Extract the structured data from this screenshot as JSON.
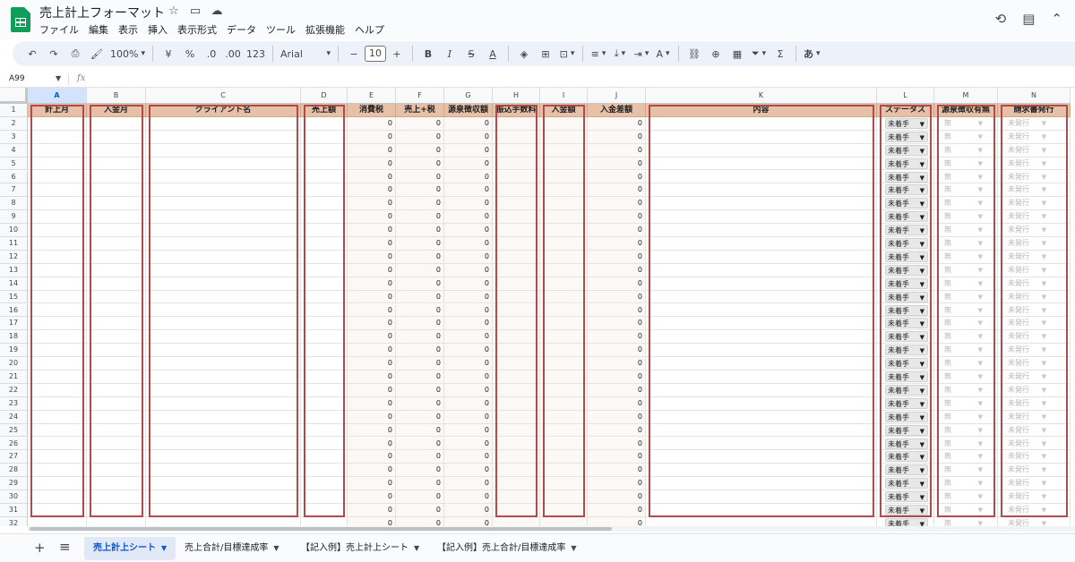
{
  "app": {
    "title": "売上計上フォーマット",
    "menu": [
      "ファイル",
      "編集",
      "表示",
      "挿入",
      "表示形式",
      "データ",
      "ツール",
      "拡張機能",
      "ヘルプ"
    ]
  },
  "toolbar": {
    "zoom": "100%",
    "currency": "¥",
    "percent": "%",
    "dec_decrease": ".0",
    "dec_increase": ".00",
    "number_format": "123",
    "font": "Arial",
    "font_size": "10",
    "bold": "B",
    "italic": "I",
    "strike": "S",
    "text_color": "A",
    "input_tool": "あ"
  },
  "formula_bar": {
    "name_box": "A99",
    "fx": "fx"
  },
  "columns": [
    "A",
    "B",
    "C",
    "D",
    "E",
    "F",
    "G",
    "H",
    "I",
    "J",
    "K",
    "L",
    "M",
    "N"
  ],
  "active_column": "A",
  "header_row": [
    "計上月",
    "入金月",
    "クライアント名",
    "売上額",
    "消費税",
    "売上+税",
    "源泉徴収額",
    "振込手数料",
    "入金額",
    "入金差額",
    "内容",
    "ステータス",
    "源泉徴収有無",
    "請求書発行"
  ],
  "rows": [
    "1",
    "2",
    "3",
    "4",
    "5",
    "6",
    "7",
    "8",
    "9",
    "10",
    "11",
    "12",
    "13",
    "14",
    "15",
    "16",
    "17",
    "18",
    "19",
    "20",
    "21",
    "22",
    "23",
    "24",
    "25",
    "26",
    "27",
    "28",
    "29",
    "30",
    "31",
    "32"
  ],
  "cell_values": {
    "zero": "0",
    "status": "未着手",
    "withholding": "無",
    "invoice": "未発行"
  },
  "sheets": [
    {
      "label": "売上計上シート",
      "active": true
    },
    {
      "label": "売上合計/目標達成率",
      "active": false
    },
    {
      "label": "【記入例】売上計上シート",
      "active": false
    },
    {
      "label": "【記入例】売上合計/目標達成率",
      "active": false
    }
  ],
  "colors": {
    "header_fill": "#e6c0a7",
    "outline": "#b14a4a",
    "brand": "#0f9d58",
    "accent": "#0b57d0"
  },
  "icons": [
    "star-icon",
    "move-folder-icon",
    "cloud-status-icon",
    "history-icon",
    "comment-icon",
    "undo-icon",
    "redo-icon",
    "print-icon",
    "paint-format-icon",
    "fill-color-icon",
    "borders-icon",
    "merge-icon",
    "align-icon",
    "valign-icon",
    "wrap-icon",
    "rotate-icon",
    "link-icon",
    "insert-comment-icon",
    "insert-chart-icon",
    "filter-icon",
    "functions-icon"
  ]
}
